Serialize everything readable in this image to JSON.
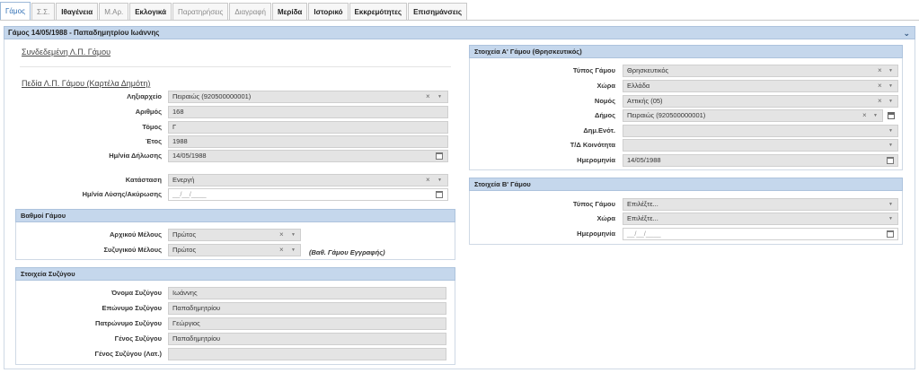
{
  "tabs": [
    {
      "label": "Γάμος",
      "style": "active"
    },
    {
      "label": "Σ.Σ.",
      "style": "muted"
    },
    {
      "label": "Ιθαγένεια",
      "style": "bold"
    },
    {
      "label": "Μ.Αρ.",
      "style": "muted"
    },
    {
      "label": "Εκλογικά",
      "style": "bold"
    },
    {
      "label": "Παρατηρήσεις",
      "style": "muted"
    },
    {
      "label": "Διαγραφή",
      "style": "muted"
    },
    {
      "label": "Μερίδα",
      "style": "bold"
    },
    {
      "label": "Ιστορικό",
      "style": "bold"
    },
    {
      "label": "Εκκρεμότητες",
      "style": "bold"
    },
    {
      "label": "Επισημάνσεις",
      "style": "bold"
    }
  ],
  "header": {
    "title": "Γάμος 14/05/1988 - Παπαδημητρίου Ιωάννης"
  },
  "links": {
    "linked": "Συνδεδεμένη Λ.Π. Γάμου",
    "fields": "Πεδία Λ.Π. Γάμου (Καρτέλα Δημότη)"
  },
  "left": {
    "registry_label": "Ληξιαρχείο",
    "registry_value": "Πειραιώς (920500000001)",
    "number_label": "Αριθμός",
    "number_value": "168",
    "volume_label": "Τόμος",
    "volume_value": "Γ",
    "year_label": "Έτος",
    "year_value": "1988",
    "decl_date_label": "Ημ/νία Δήλωσης",
    "decl_date_value": "14/05/1988",
    "status_label": "Κατάσταση",
    "status_value": "Ενεργή",
    "dissolution_label": "Ημ/νία Λύσης/Ακύρωσης",
    "dissolution_value": "__/__/____"
  },
  "degrees": {
    "title": "Βαθμοί Γάμου",
    "original_label": "Αρχικού Μέλους",
    "original_value": "Πρώτος",
    "spouse_label": "Συζυγικού Μέλους",
    "spouse_value": "Πρώτος",
    "note": "(Βαθ. Γάμου Εγγραφής)"
  },
  "spouse": {
    "title": "Στοιχεία Συζύγου",
    "name_label": "Όνομα Συζύγου",
    "name_value": "Ιωάννης",
    "surname_label": "Επώνυμο Συζύγου",
    "surname_value": "Παπαδημητρίου",
    "father_label": "Πατρώνυμο Συζύγου",
    "father_value": "Γεώργιος",
    "genus_label": "Γένος Συζύγου",
    "genus_value": "Παπαδημητρίου",
    "genus_lat_label": "Γένος Συζύγου (Λατ.)",
    "genus_lat_value": ""
  },
  "marriage_a": {
    "title": "Στοιχεία Α' Γάμου (Θρησκευτικός)",
    "type_label": "Τύπος Γάμου",
    "type_value": "Θρησκευτικός",
    "country_label": "Χώρα",
    "country_value": "Ελλάδα",
    "prefecture_label": "Νομός",
    "prefecture_value": "Αττικής (05)",
    "municipality_label": "Δήμος",
    "municipality_value": "Πειραιώς (920500000001)",
    "unit_label": "Δημ.Ενότ.",
    "unit_value": "",
    "community_label": "Τ/Δ Κοινότητα",
    "community_value": "",
    "date_label": "Ημερομηνία",
    "date_value": "14/05/1988"
  },
  "marriage_b": {
    "title": "Στοιχεία Β' Γάμου",
    "type_label": "Τύπος Γάμου",
    "type_value": "Επιλέξτε...",
    "country_label": "Χώρα",
    "country_value": "Επιλέξτε...",
    "date_label": "Ημερομηνία",
    "date_value": "__/__/____"
  },
  "icons": {
    "clear": "×",
    "dropdown": "▼",
    "collapse": "⌄"
  }
}
